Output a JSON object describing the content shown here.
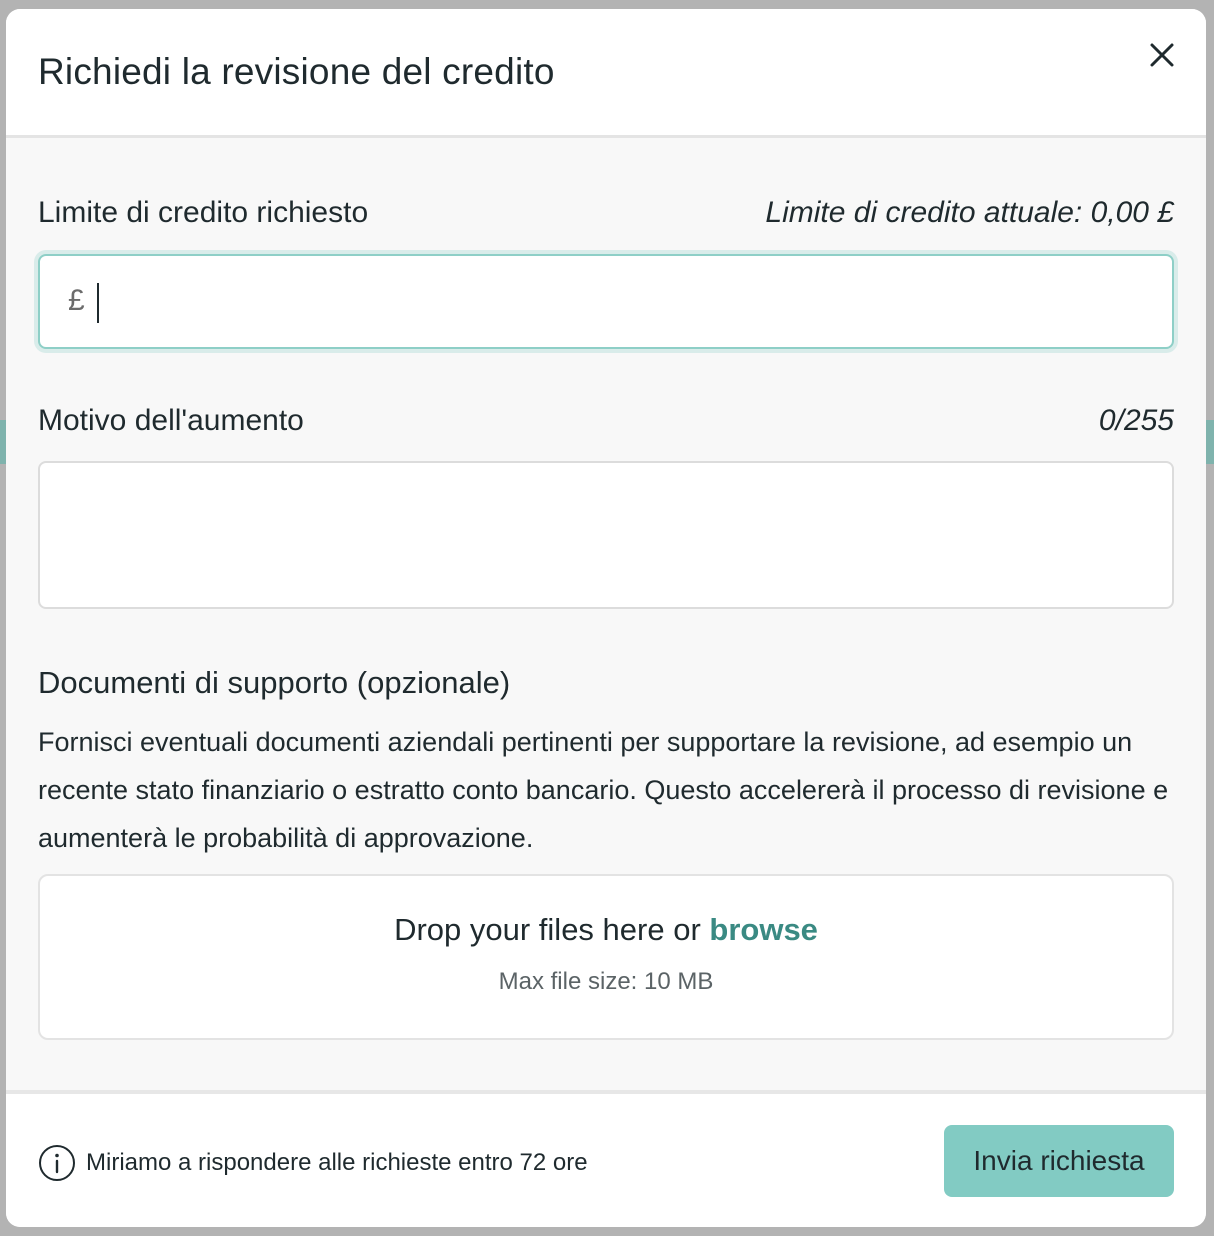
{
  "modal": {
    "title": "Richiedi la revisione del credito",
    "close_icon": "close-icon"
  },
  "credit_limit": {
    "label": "Limite di credito richiesto",
    "current_text": "Limite di credito attuale: 0,00 £",
    "currency_symbol": "£",
    "value": "",
    "placeholder": ""
  },
  "reason": {
    "label": "Motivo dell'aumento",
    "counter": "0/255",
    "value": ""
  },
  "documents": {
    "title": "Documenti di supporto (opzionale)",
    "description": "Fornisci eventuali documenti aziendali pertinenti per supportare la revisione, ad esempio un recente stato finanziario o estratto conto bancario. Questo accelererà il processo di revisione e aumenterà le probabilità di approvazione.",
    "drop_text": "Drop your files here or",
    "browse_label": "browse",
    "max_size": "Max file size: 10 MB"
  },
  "footer": {
    "info_icon": "info-icon",
    "info_text": "Miriamo a rispondere alle richieste entro 72 ore",
    "submit_label": "Invia richiesta"
  },
  "colors": {
    "accent": "#82cbc3",
    "link": "#3a8a83",
    "focus_border": "#8ecfc7"
  }
}
